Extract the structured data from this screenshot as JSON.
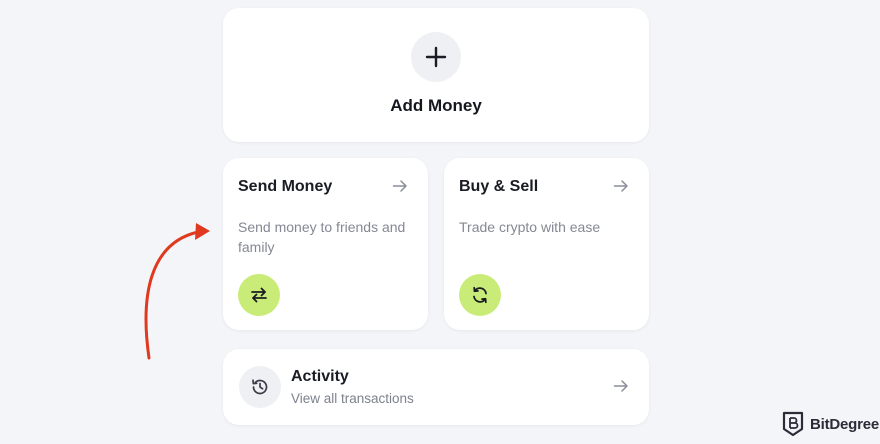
{
  "add_money": {
    "label": "Add Money",
    "icon": "plus-icon"
  },
  "send_money": {
    "title": "Send Money",
    "description": "Send money to friends and family",
    "icon": "swap-arrows-icon"
  },
  "buy_sell": {
    "title": "Buy & Sell",
    "description": "Trade crypto with ease",
    "icon": "refresh-icon"
  },
  "activity": {
    "title": "Activity",
    "subtitle": "View all transactions",
    "icon": "history-icon"
  },
  "watermark": {
    "brand": "BitDegree"
  },
  "colors": {
    "background": "#f4f5f8",
    "card": "#ffffff",
    "accent_green": "#c9ec78",
    "annotation_arrow": "#e0391f"
  }
}
